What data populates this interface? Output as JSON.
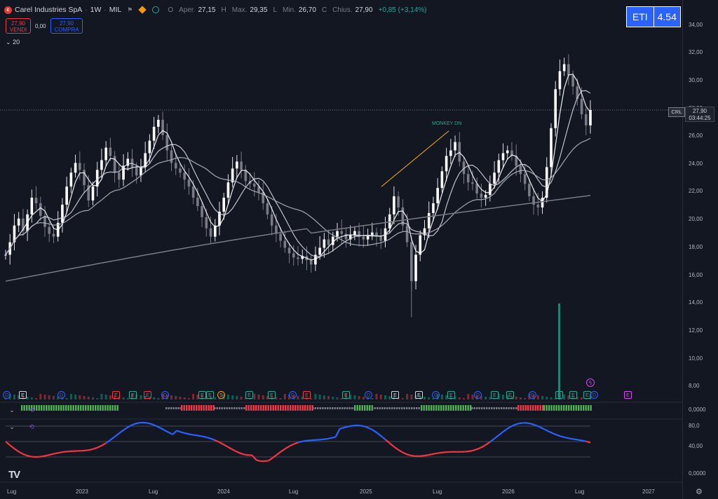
{
  "header": {
    "symbol": "Carel Industries SpA",
    "interval": "1W",
    "exchange": "MIL",
    "open_label": "O",
    "open_text": "Aper.",
    "open": "27,15",
    "high_label": "H",
    "high_text": "Max.",
    "high": "29,35",
    "low_label": "L",
    "low_text": "Min.",
    "low": "26,70",
    "close_label": "C",
    "close_text": "Chius.",
    "close": "27,90",
    "change": "+0,85 (+3,14%)"
  },
  "trading": {
    "sell_price": "27,90",
    "sell_label": "VENDI",
    "spread": "0,00",
    "buy_price": "27,90",
    "buy_label": "COMPRA"
  },
  "indicator_period": "20",
  "eti": {
    "label": "ETI",
    "value": "4.54"
  },
  "price_tag": {
    "symbol": "CRL",
    "price": "27,90",
    "countdown": "03:44:25"
  },
  "annotation": "MONKEY DN",
  "price_axis": [
    "34,00",
    "32,00",
    "30,00",
    "28,00",
    "26,00",
    "24,00",
    "22,00",
    "20,00",
    "18,00",
    "16,00",
    "14,00",
    "12,00",
    "10,00",
    "8,00"
  ],
  "pane1_axis": [
    "0,0000"
  ],
  "pane2_axis": [
    "80,0",
    "40,00"
  ],
  "pane3_axis": [
    "0,0000"
  ],
  "time_axis": [
    "Lug",
    "2023",
    "Lug",
    "2024",
    "Lug",
    "2025",
    "Lug",
    "2026",
    "Lug",
    "2027"
  ],
  "event_badges": [
    "D",
    "E",
    "D",
    "E",
    "E",
    "E",
    "D",
    "E",
    "E",
    "S",
    "E",
    "E",
    "D",
    "E",
    "E",
    "D",
    "E",
    "E",
    "D",
    "E",
    "D",
    "E",
    "E",
    "D",
    "E",
    "E",
    "E",
    "D",
    "E",
    "E"
  ],
  "colors": {
    "background": "#131722",
    "up": "#ffffff",
    "down": "#787b86",
    "bull": "#22ab94",
    "bear": "#f23645",
    "osc_up": "#2962ff",
    "accent": "#2962ff"
  },
  "chart_data": {
    "type": "candlestick",
    "ylim": [
      8,
      34
    ],
    "close_price": 27.9,
    "weekly_closes": [
      17.5,
      18.4,
      19.6,
      20.1,
      19.2,
      20.4,
      21.6,
      21.2,
      20.3,
      19.5,
      19.0,
      18.8,
      19.8,
      21.1,
      22.4,
      23.4,
      24.1,
      23.6,
      22.5,
      21.4,
      22.4,
      23.6,
      24.3,
      25.2,
      24.6,
      23.4,
      22.9,
      23.9,
      24.4,
      23.8,
      23.2,
      23.8,
      24.8,
      25.7,
      26.7,
      27.2,
      26.1,
      25.0,
      24.1,
      23.7,
      23.4,
      22.9,
      22.4,
      21.6,
      21.0,
      20.2,
      19.4,
      18.8,
      19.6,
      20.6,
      21.6,
      22.7,
      23.7,
      24.2,
      23.6,
      22.8,
      22.6,
      22.4,
      22.0,
      21.2,
      20.4,
      19.6,
      19.0,
      18.5,
      18.0,
      17.6,
      17.3,
      17.2,
      17.4,
      17.1,
      16.8,
      17.5,
      18.0,
      18.6,
      18.2,
      18.8,
      19.2,
      19.0,
      18.6,
      18.9,
      19.2,
      18.8,
      18.6,
      18.9,
      19.1,
      18.8,
      18.5,
      19.4,
      20.4,
      21.7,
      20.9,
      19.6,
      18.4,
      15.6,
      17.5,
      18.9,
      19.4,
      20.5,
      21.2,
      22.3,
      23.5,
      24.6,
      25.0,
      25.6,
      24.2,
      23.3,
      22.7,
      22.6,
      21.9,
      21.6,
      21.8,
      22.6,
      23.4,
      24.3,
      24.8,
      25.0,
      24.6,
      23.9,
      23.3,
      22.6,
      21.7,
      21.1,
      20.9,
      21.6,
      23.8,
      26.6,
      29.4,
      30.7,
      31.2,
      30.4,
      29.6,
      28.7,
      27.6,
      26.8,
      27.9
    ],
    "moving_averages": [
      {
        "period": 10,
        "color": "#ffffff"
      },
      {
        "period": 20,
        "color": "#d1d4dc"
      },
      {
        "period": 50,
        "color": "#b2b5be"
      },
      {
        "period": 200,
        "color": "#787b86"
      }
    ],
    "volume_spike": 14.0
  }
}
